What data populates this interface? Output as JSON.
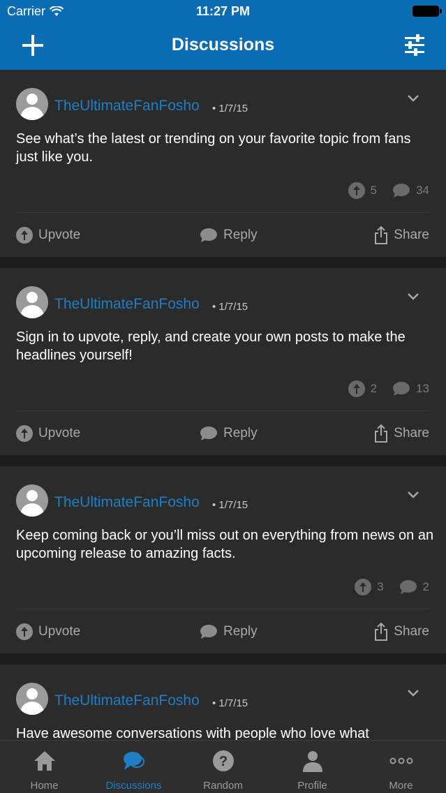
{
  "status_bar": {
    "carrier": "Carrier",
    "time": "11:27 PM"
  },
  "nav": {
    "title": "Discussions",
    "left_icon": "plus-icon",
    "right_icon": "filter-sliders-icon"
  },
  "posts": [
    {
      "author": "TheUltimateFanFosho",
      "date": "• 1/7/15",
      "text": "See what’s the latest or trending on your favorite topic from fans just like you.",
      "upvotes": "5",
      "comments": "34"
    },
    {
      "author": "TheUltimateFanFosho",
      "date": "• 1/7/15",
      "text": "Sign in to upvote, reply, and create your own posts to make the headlines yourself!",
      "upvotes": "2",
      "comments": "13"
    },
    {
      "author": "TheUltimateFanFosho",
      "date": "• 1/7/15",
      "text": "Keep coming back or you’ll miss out on everything from news on an upcoming release to amazing facts.",
      "upvotes": "3",
      "comments": "2"
    },
    {
      "author": "TheUltimateFanFosho",
      "date": "• 1/7/15",
      "text": "Have awesome conversations with people who love what"
    }
  ],
  "actions": {
    "upvote": "Upvote",
    "reply": "Reply",
    "share": "Share"
  },
  "tabs": [
    {
      "label": "Home",
      "icon": "home-icon"
    },
    {
      "label": "Discussions",
      "icon": "discussions-icon",
      "active": true
    },
    {
      "label": "Random",
      "icon": "question-icon"
    },
    {
      "label": "Profile",
      "icon": "profile-icon"
    },
    {
      "label": "More",
      "icon": "more-dots-icon"
    }
  ],
  "colors": {
    "header": "#0a6cb3",
    "accent": "#1f7ec4",
    "card": "#2b2b2b",
    "background": "#1c1c1c"
  }
}
